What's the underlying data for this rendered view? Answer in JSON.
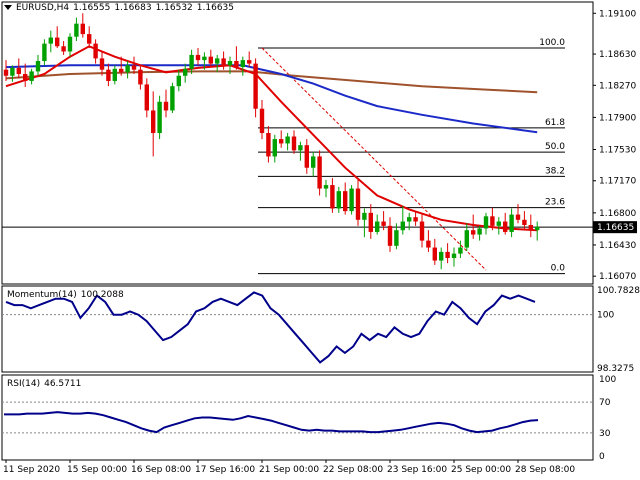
{
  "header": {
    "symbol": "EURUSD,H4",
    "open": "1.16555",
    "high": "1.16683",
    "low": "1.16532",
    "close": "1.16635"
  },
  "momentum_header": {
    "label": "Momentum(14)",
    "value": "100.2088"
  },
  "rsi_header": {
    "label": "RSI(14)",
    "value": "46.5711"
  },
  "colors": {
    "bull": "#00a000",
    "bear": "#e00000",
    "fast_ma": "#e00000",
    "slow_ma": "#1c2ac8",
    "long_ma": "#a0522d",
    "osc": "#00008b",
    "fib": "#000000"
  },
  "chart_data": [
    {
      "type": "candlestick",
      "name": "price",
      "ylim": [
        1.1598,
        1.1923
      ],
      "y_ticks": [
        "1.19100",
        "1.18630",
        "1.18270",
        "1.17900",
        "1.17530",
        "1.17170",
        "1.16800",
        "1.16430",
        "1.16070"
      ],
      "current_price": "1.16635",
      "x_tick_labels": [
        "11 Sep 2020",
        "15 Sep 00:00",
        "16 Sep 08:00",
        "17 Sep 16:00",
        "21 Sep 00:00",
        "22 Sep 08:00",
        "23 Sep 16:00",
        "25 Sep 00:00",
        "28 Sep 08:00"
      ],
      "x_tick_index": [
        0,
        10,
        20,
        30,
        40,
        50,
        60,
        70,
        80
      ],
      "candles": [
        [
          1.1845,
          1.1856,
          1.1832,
          1.1838
        ],
        [
          1.1838,
          1.185,
          1.1831,
          1.1847
        ],
        [
          1.1847,
          1.1858,
          1.1835,
          1.184
        ],
        [
          1.184,
          1.1852,
          1.1825,
          1.1832
        ],
        [
          1.1832,
          1.1846,
          1.1828,
          1.1843
        ],
        [
          1.1843,
          1.1862,
          1.1838,
          1.1855
        ],
        [
          1.1855,
          1.188,
          1.185,
          1.1875
        ],
        [
          1.1875,
          1.189,
          1.1865,
          1.1882
        ],
        [
          1.1882,
          1.1895,
          1.187,
          1.1872
        ],
        [
          1.1872,
          1.1878,
          1.1862,
          1.1866
        ],
        [
          1.1866,
          1.1887,
          1.186,
          1.1883
        ],
        [
          1.1883,
          1.1905,
          1.1878,
          1.1898
        ],
        [
          1.1898,
          1.191,
          1.1882,
          1.1886
        ],
        [
          1.1886,
          1.1895,
          1.187,
          1.1875
        ],
        [
          1.1875,
          1.188,
          1.1852,
          1.1858
        ],
        [
          1.1858,
          1.1865,
          1.1838,
          1.1845
        ],
        [
          1.1845,
          1.1852,
          1.1826,
          1.1832
        ],
        [
          1.1832,
          1.185,
          1.1828,
          1.1846
        ],
        [
          1.1846,
          1.186,
          1.1838,
          1.1842
        ],
        [
          1.1842,
          1.1855,
          1.1835,
          1.185
        ],
        [
          1.185,
          1.186,
          1.184,
          1.1845
        ],
        [
          1.1845,
          1.185,
          1.1822,
          1.1828
        ],
        [
          1.1828,
          1.1835,
          1.179,
          1.1798
        ],
        [
          1.1798,
          1.182,
          1.1745,
          1.1772
        ],
        [
          1.1772,
          1.1815,
          1.1765,
          1.1808
        ],
        [
          1.1808,
          1.1822,
          1.179,
          1.1798
        ],
        [
          1.1798,
          1.183,
          1.1795,
          1.1826
        ],
        [
          1.1826,
          1.1845,
          1.182,
          1.1838
        ],
        [
          1.1838,
          1.1852,
          1.183,
          1.1846
        ],
        [
          1.1846,
          1.1868,
          1.184,
          1.1862
        ],
        [
          1.1862,
          1.187,
          1.185,
          1.1856
        ],
        [
          1.1856,
          1.1865,
          1.1845,
          1.186
        ],
        [
          1.186,
          1.1868,
          1.1848,
          1.1852
        ],
        [
          1.1852,
          1.1862,
          1.1842,
          1.1858
        ],
        [
          1.1858,
          1.1866,
          1.1845,
          1.185
        ],
        [
          1.185,
          1.186,
          1.184,
          1.1855
        ],
        [
          1.1855,
          1.1872,
          1.1845,
          1.1848
        ],
        [
          1.1848,
          1.186,
          1.1838,
          1.1856
        ],
        [
          1.1856,
          1.1866,
          1.1848,
          1.1852
        ],
        [
          1.1852,
          1.1858,
          1.179,
          1.18
        ],
        [
          1.18,
          1.181,
          1.1765,
          1.1772
        ],
        [
          1.1772,
          1.178,
          1.1738,
          1.1745
        ],
        [
          1.1745,
          1.177,
          1.1738,
          1.1765
        ],
        [
          1.1765,
          1.1775,
          1.1755,
          1.176
        ],
        [
          1.176,
          1.1772,
          1.1752,
          1.1768
        ],
        [
          1.1768,
          1.1775,
          1.1748,
          1.1752
        ],
        [
          1.1752,
          1.1762,
          1.174,
          1.1758
        ],
        [
          1.1758,
          1.1765,
          1.1725,
          1.1732
        ],
        [
          1.1732,
          1.175,
          1.1722,
          1.1745
        ],
        [
          1.1745,
          1.1752,
          1.17,
          1.1708
        ],
        [
          1.1708,
          1.1718,
          1.1698,
          1.1712
        ],
        [
          1.1712,
          1.172,
          1.168,
          1.1685
        ],
        [
          1.1685,
          1.171,
          1.168,
          1.1705
        ],
        [
          1.1705,
          1.1715,
          1.1678,
          1.1682
        ],
        [
          1.1682,
          1.1712,
          1.1678,
          1.1708
        ],
        [
          1.1708,
          1.1718,
          1.1665,
          1.1672
        ],
        [
          1.1672,
          1.1685,
          1.1652,
          1.168
        ],
        [
          1.168,
          1.169,
          1.165,
          1.1658
        ],
        [
          1.1658,
          1.1678,
          1.1655,
          1.167
        ],
        [
          1.167,
          1.1682,
          1.166,
          1.1665
        ],
        [
          1.1665,
          1.1675,
          1.1635,
          1.1642
        ],
        [
          1.1642,
          1.1668,
          1.1638,
          1.166
        ],
        [
          1.166,
          1.1688,
          1.1655,
          1.167
        ],
        [
          1.167,
          1.168,
          1.166,
          1.1675
        ],
        [
          1.1675,
          1.1682,
          1.1665,
          1.167
        ],
        [
          1.167,
          1.1678,
          1.164,
          1.1648
        ],
        [
          1.1648,
          1.166,
          1.1635,
          1.164
        ],
        [
          1.164,
          1.165,
          1.162,
          1.1625
        ],
        [
          1.1625,
          1.164,
          1.1615,
          1.1635
        ],
        [
          1.1635,
          1.1645,
          1.1622,
          1.1628
        ],
        [
          1.1628,
          1.164,
          1.1618,
          1.1633
        ],
        [
          1.1633,
          1.1648,
          1.1628,
          1.164
        ],
        [
          1.164,
          1.1668,
          1.1636,
          1.166
        ],
        [
          1.166,
          1.1678,
          1.165,
          1.1655
        ],
        [
          1.1655,
          1.1665,
          1.1648,
          1.1662
        ],
        [
          1.1662,
          1.168,
          1.1655,
          1.1676
        ],
        [
          1.1676,
          1.1686,
          1.166,
          1.1665
        ],
        [
          1.1665,
          1.1675,
          1.1655,
          1.167
        ],
        [
          1.167,
          1.168,
          1.1655,
          1.1658
        ],
        [
          1.1658,
          1.1685,
          1.1652,
          1.1678
        ],
        [
          1.1678,
          1.169,
          1.1668,
          1.1672
        ],
        [
          1.1672,
          1.1682,
          1.166,
          1.1666
        ],
        [
          1.1666,
          1.1678,
          1.1652,
          1.166
        ],
        [
          1.166,
          1.167,
          1.1648,
          1.1664
        ]
      ],
      "fast_ma": [
        [
          0,
          1.1826
        ],
        [
          6,
          1.184
        ],
        [
          10,
          1.186
        ],
        [
          13,
          1.1872
        ],
        [
          17,
          1.186
        ],
        [
          21,
          1.185
        ],
        [
          25,
          1.1842
        ],
        [
          30,
          1.1847
        ],
        [
          35,
          1.185
        ],
        [
          39,
          1.184
        ],
        [
          43,
          1.1808
        ],
        [
          48,
          1.177
        ],
        [
          53,
          1.1732
        ],
        [
          58,
          1.17
        ],
        [
          63,
          1.1684
        ],
        [
          68,
          1.1672
        ],
        [
          73,
          1.1666
        ],
        [
          78,
          1.1662
        ],
        [
          83,
          1.166
        ]
      ],
      "slow_ma": [
        [
          0,
          1.1848
        ],
        [
          10,
          1.185
        ],
        [
          20,
          1.185
        ],
        [
          30,
          1.185
        ],
        [
          37,
          1.185
        ],
        [
          43,
          1.184
        ],
        [
          48,
          1.1829
        ],
        [
          53,
          1.1815
        ],
        [
          58,
          1.1803
        ],
        [
          65,
          1.1793
        ],
        [
          73,
          1.1783
        ],
        [
          83,
          1.1773
        ]
      ],
      "long_ma": [
        [
          0,
          1.1835
        ],
        [
          10,
          1.184
        ],
        [
          20,
          1.1842
        ],
        [
          30,
          1.1843
        ],
        [
          38,
          1.1843
        ],
        [
          45,
          1.1838
        ],
        [
          55,
          1.1832
        ],
        [
          65,
          1.1826
        ],
        [
          75,
          1.1822
        ],
        [
          83,
          1.1819
        ]
      ],
      "fibonacci": {
        "levels": [
          [
            "100.0",
            1.187
          ],
          [
            "61.8",
            1.1778
          ],
          [
            "50.0",
            1.175
          ],
          [
            "38.2",
            1.1722
          ],
          [
            "23.6",
            1.1686
          ],
          [
            "0.0",
            1.161
          ]
        ],
        "diagonal": [
          [
            40,
            1.187
          ],
          [
            75,
            1.1614
          ]
        ]
      }
    },
    {
      "type": "line",
      "name": "Momentum(14)",
      "y_ticks": [
        "100.7828",
        "100",
        "98.3275"
      ],
      "ylim": [
        98.2,
        100.9
      ],
      "reference_level": 100,
      "values": [
        100.4,
        100.3,
        100.3,
        100.2,
        100.3,
        100.4,
        100.5,
        100.5,
        100.4,
        99.9,
        100.2,
        100.6,
        100.4,
        100.0,
        100.0,
        100.1,
        100.0,
        99.8,
        99.5,
        99.2,
        99.3,
        99.5,
        99.7,
        100.1,
        100.2,
        100.4,
        100.5,
        100.4,
        100.3,
        100.5,
        100.7,
        100.6,
        100.2,
        100.0,
        99.7,
        99.4,
        99.1,
        98.8,
        98.5,
        98.7,
        99.0,
        98.8,
        99.0,
        99.4,
        99.2,
        99.4,
        99.3,
        99.6,
        99.4,
        99.3,
        99.4,
        99.8,
        100.1,
        100.0,
        100.4,
        100.2,
        99.9,
        99.7,
        100.1,
        100.3,
        100.6,
        100.5,
        100.6,
        100.5,
        100.4
      ]
    },
    {
      "type": "line",
      "name": "RSI(14)",
      "y_ticks": [
        "100",
        "70",
        "30",
        "0"
      ],
      "ylim": [
        0,
        100
      ],
      "reference_levels": [
        70,
        30
      ],
      "values": [
        54,
        54,
        54,
        55,
        55,
        55,
        56,
        57,
        56,
        55,
        55,
        56,
        55,
        53,
        50,
        47,
        44,
        40,
        36,
        33,
        31,
        37,
        40,
        43,
        46,
        49,
        50,
        50,
        49,
        48,
        47,
        49,
        52,
        50,
        48,
        46,
        43,
        40,
        37,
        34,
        33,
        34,
        33,
        33,
        32,
        32,
        32,
        32,
        31,
        31,
        32,
        33,
        34,
        36,
        38,
        40,
        42,
        43,
        42,
        40,
        36,
        33,
        31,
        32,
        33,
        36,
        38,
        41,
        44,
        46,
        46.5711
      ]
    }
  ]
}
